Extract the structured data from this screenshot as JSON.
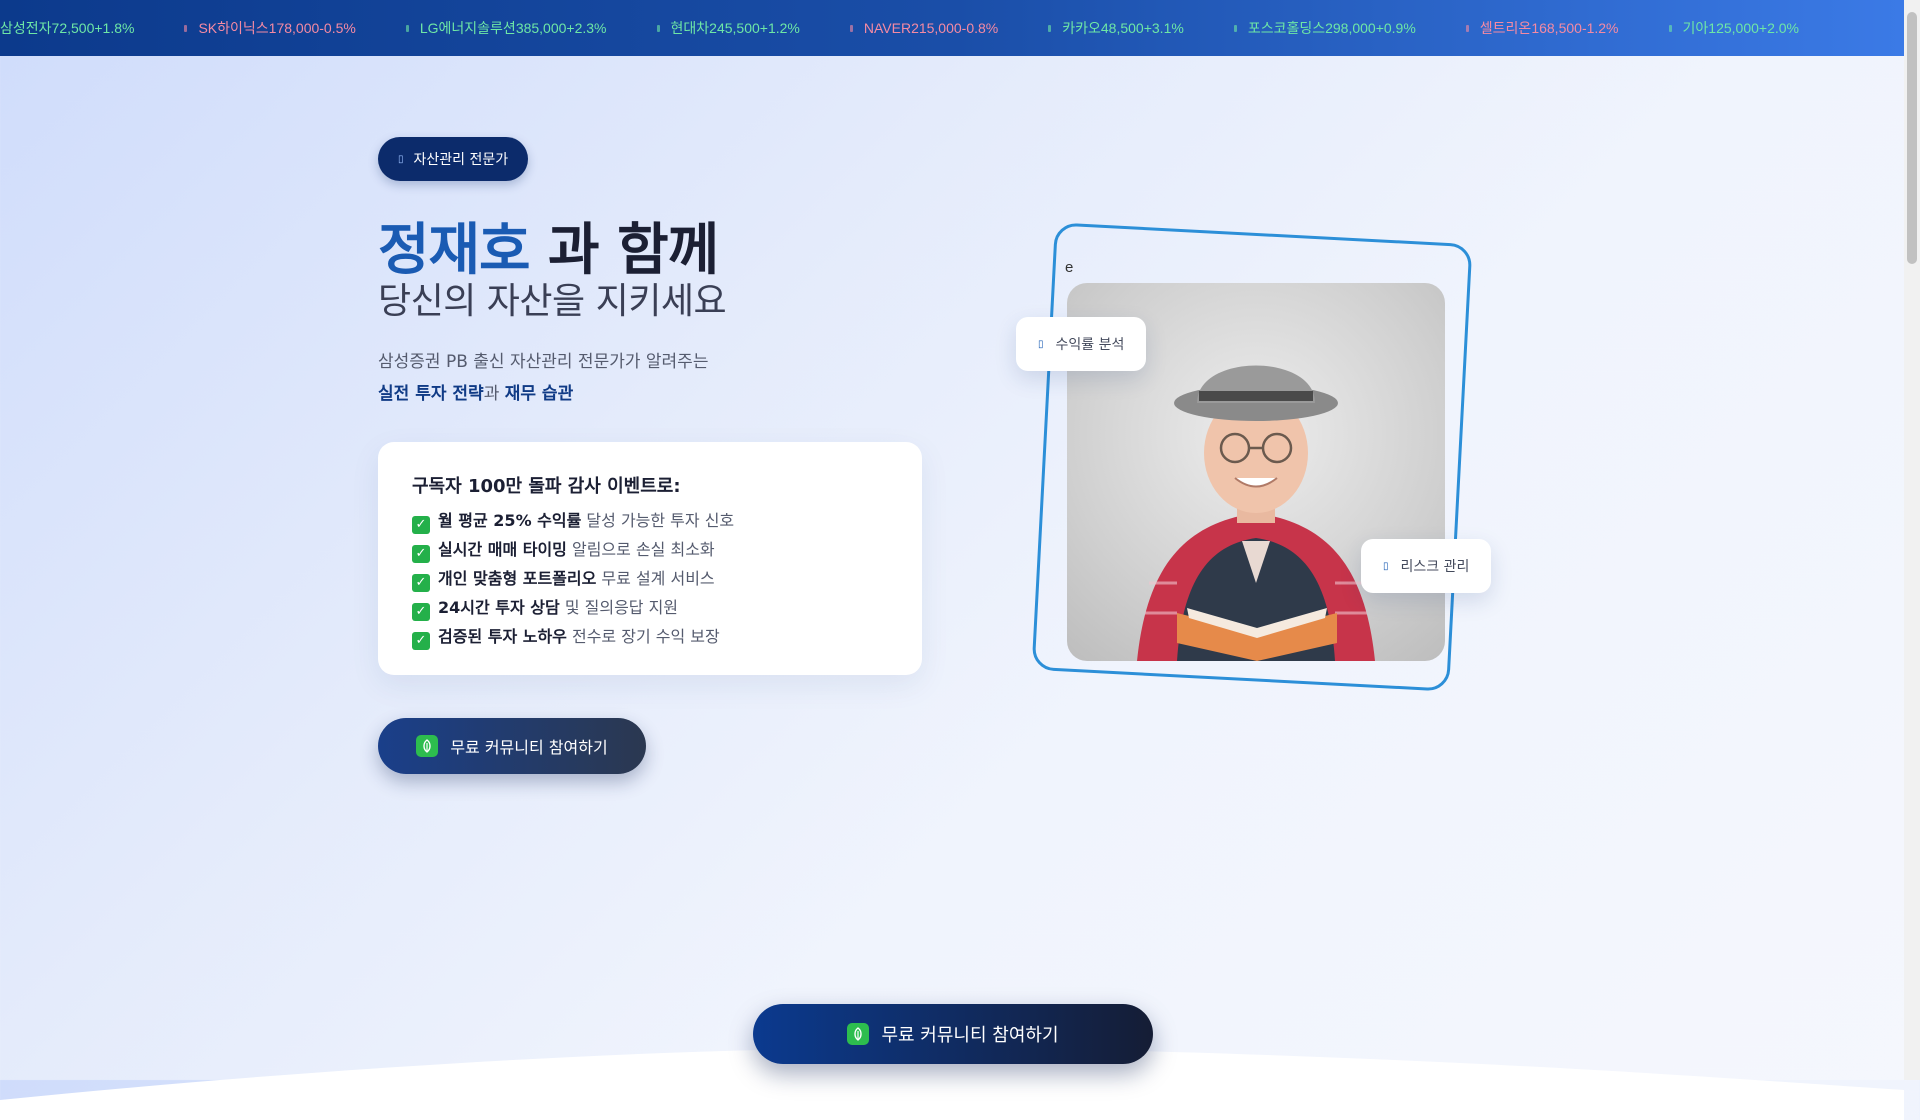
{
  "ticker": [
    {
      "name": "삼성전자",
      "price": "72,500",
      "change": "+1.8%",
      "dir": "up"
    },
    {
      "name": "SK하이닉스",
      "price": "178,000",
      "change": "-0.5%",
      "dir": "down"
    },
    {
      "name": "LG에너지솔루션",
      "price": "385,000",
      "change": "+2.3%",
      "dir": "up"
    },
    {
      "name": "현대차",
      "price": "245,500",
      "change": "+1.2%",
      "dir": "up"
    },
    {
      "name": "NAVER",
      "price": "215,000",
      "change": "-0.8%",
      "dir": "down"
    },
    {
      "name": "카카오",
      "price": "48,500",
      "change": "+3.1%",
      "dir": "up"
    },
    {
      "name": "포스코홀딩스",
      "price": "298,000",
      "change": "+0.9%",
      "dir": "up"
    },
    {
      "name": "셀트리온",
      "price": "168,500",
      "change": "-1.2%",
      "dir": "down"
    },
    {
      "name": "기아",
      "price": "125,000",
      "change": "+2.0%",
      "dir": "up"
    }
  ],
  "hero": {
    "badge": "자산관리 전문가",
    "name": "정재호",
    "title_rest": " 과 함께",
    "subtitle": "당신의 자산을 지키세요",
    "intro_line1": "삼성증권 PB 출신 자산관리 전문가가 알려주는",
    "intro_strong1": "실전 투자 전략",
    "intro_conj": "과 ",
    "intro_strong2": "재무 습관"
  },
  "benefits": {
    "title": "구독자 100만 돌파 감사 이벤트로:",
    "items": [
      {
        "strong": "월 평균 25% 수익률",
        "rest": " 달성 가능한 투자 신호"
      },
      {
        "strong": "실시간 매매 타이밍",
        "rest": " 알림으로 손실 최소화"
      },
      {
        "strong": "개인 맞춤형 포트폴리오",
        "rest": " 무료 설계 서비스"
      },
      {
        "strong": "24시간 투자 상담",
        "rest": " 및 질의응답 지원"
      },
      {
        "strong": "검증된 투자 노하우",
        "rest": " 전수로 장기 수익 보장"
      }
    ]
  },
  "cta_label": "무료 커뮤니티 참여하기",
  "image_alt": "e",
  "tags": {
    "profit": "수익률 분석",
    "risk": "리스크 관리"
  },
  "colors": {
    "accent": "#1a5bb3",
    "ticker_up": "#6ee7a6",
    "ticker_down": "#f58aa3",
    "check": "#24b04a",
    "frame": "#2c8fd8"
  }
}
